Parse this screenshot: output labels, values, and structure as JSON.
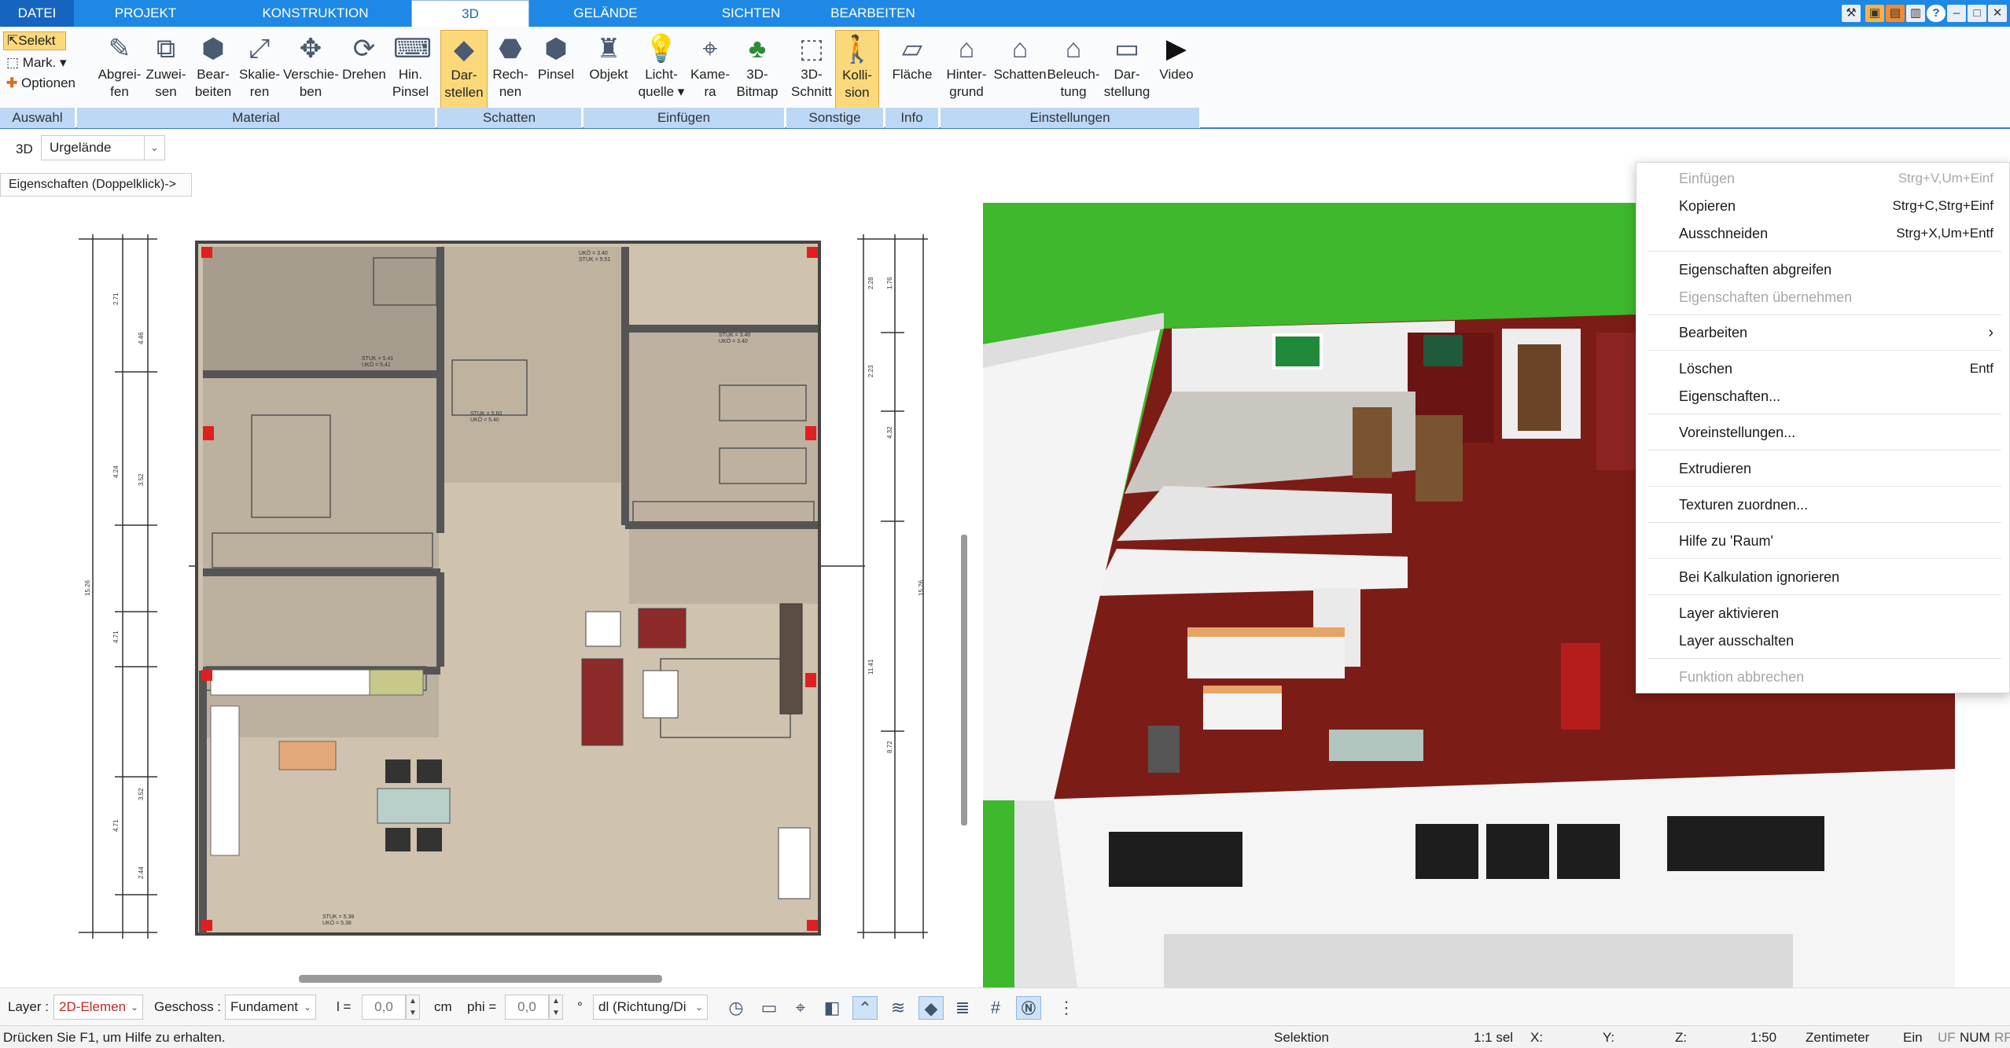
{
  "tabs": {
    "file": "DATEI",
    "projekt": "PROJEKT",
    "konstruktion": "KONSTRUKTION",
    "d3": "3D",
    "gelaende": "GELÄNDE",
    "sichten": "SICHTEN",
    "bearbeiten": "BEARBEITEN"
  },
  "ribbon": {
    "auswahl": {
      "selekt": "Selekt",
      "mark": "Mark.",
      "optionen": "Optionen",
      "group": "Auswahl"
    },
    "material": {
      "abgreifen": "Abgrei-\nfen",
      "zuweisen": "Zuwei-\nsen",
      "bearbeiten": "Bear-\nbeiten",
      "skalieren": "Skalie-\nren",
      "verschieben": "Verschie-\nben",
      "drehen": "Drehen",
      "pinsel": "Hin.\nPinsel",
      "group": "Material"
    },
    "schatten": {
      "darstellen": "Dar-\nstellen",
      "rechnen": "Rech-\nnen",
      "pinsel": "Pinsel",
      "group": "Schatten"
    },
    "einfuegen": {
      "objekt": "Objekt",
      "licht": "Licht-\nquelle ▾",
      "kamera": "Kame-\nra",
      "bitmap": "3D-\nBitmap",
      "group": "Einfügen"
    },
    "sonstige": {
      "schnitt": "3D-\nSchnitt",
      "kollision": "Kolli-\nsion",
      "group": "Sonstige"
    },
    "info": {
      "flaeche": "Fläche",
      "group": "Info"
    },
    "einstellungen": {
      "hintergrund": "Hinter-\ngrund",
      "schatten": "Schatten",
      "beleuchtung": "Beleuch-\ntung",
      "darstellung": "Dar-\nstellung",
      "video": "Video",
      "group": "Einstellungen"
    }
  },
  "toolbar2": {
    "btn3d": "3D",
    "terrain": "Urgelände"
  },
  "properties_button": "Eigenschaften (Doppelklick)->",
  "plan": {
    "labels": [
      "STUK = 5.41",
      "UKÖ = 5.41",
      "STUK = 5.60",
      "UKÖ = 5.40",
      "STUK = 3.40",
      "UKÖ = 3.40",
      "STUK = 5.38",
      "UKÖ = 5.38",
      "UKÖ = 3.40",
      "STUK = 5.51"
    ],
    "dims_left": [
      "2.71",
      "4.46",
      "4.24",
      "3.52",
      "4.71",
      "3.52",
      "2.44",
      "15.26",
      "4.71"
    ],
    "dims_right": [
      "2.28",
      "1.76",
      "2.23",
      "4.32",
      "11.41",
      "8.72",
      "15.26"
    ]
  },
  "context_menu": {
    "einfuegen": {
      "label": "Einfügen",
      "shortcut": "Strg+V,Um+Einf"
    },
    "kopieren": {
      "label": "Kopieren",
      "shortcut": "Strg+C,Strg+Einf"
    },
    "ausschneiden": {
      "label": "Ausschneiden",
      "shortcut": "Strg+X,Um+Entf"
    },
    "abgreifen": "Eigenschaften abgreifen",
    "uebernehmen": "Eigenschaften übernehmen",
    "bearbeiten": "Bearbeiten",
    "bearbeiten_arrow": "›",
    "loeschen": {
      "label": "Löschen",
      "shortcut": "Entf"
    },
    "eigenschaften": "Eigenschaften...",
    "voreinstellungen": "Voreinstellungen...",
    "extrudieren": "Extrudieren",
    "texturen": "Texturen zuordnen...",
    "hilfe": "Hilfe zu 'Raum'",
    "kalkulation": "Bei Kalkulation ignorieren",
    "layer_aktivieren": "Layer aktivieren",
    "layer_ausschalten": "Layer ausschalten",
    "abbrechen": "Funktion abbrechen"
  },
  "bottombar": {
    "layer_label": "Layer :",
    "layer_value": "2D-Elemente",
    "geschoss_label": "Geschoss :",
    "geschoss_value": "Fundament",
    "l_label": "l =",
    "l_value": "0,0",
    "cm": "cm",
    "phi_label": "phi =",
    "phi_value": "0,0",
    "deg": "°",
    "dir_value": "dl (Richtung/Di"
  },
  "status": {
    "help": "Drücken Sie F1, um Hilfe zu erhalten.",
    "mode": "Selektion",
    "sel": "1:1 sel",
    "x": "X:",
    "y": "Y:",
    "z": "Z:",
    "scale": "1:50",
    "unit": "Zentimeter",
    "ein": "Ein",
    "uf": "UF",
    "num": "NUM",
    "rf": "RF"
  },
  "colors": {
    "accent": "#1e88e5",
    "ribbon_selected": "#fbd97a",
    "group_label": "#bcd8f5",
    "floor": "#cfc2ae",
    "grass": "#3eb82c",
    "carpet": "#7c1c16"
  }
}
